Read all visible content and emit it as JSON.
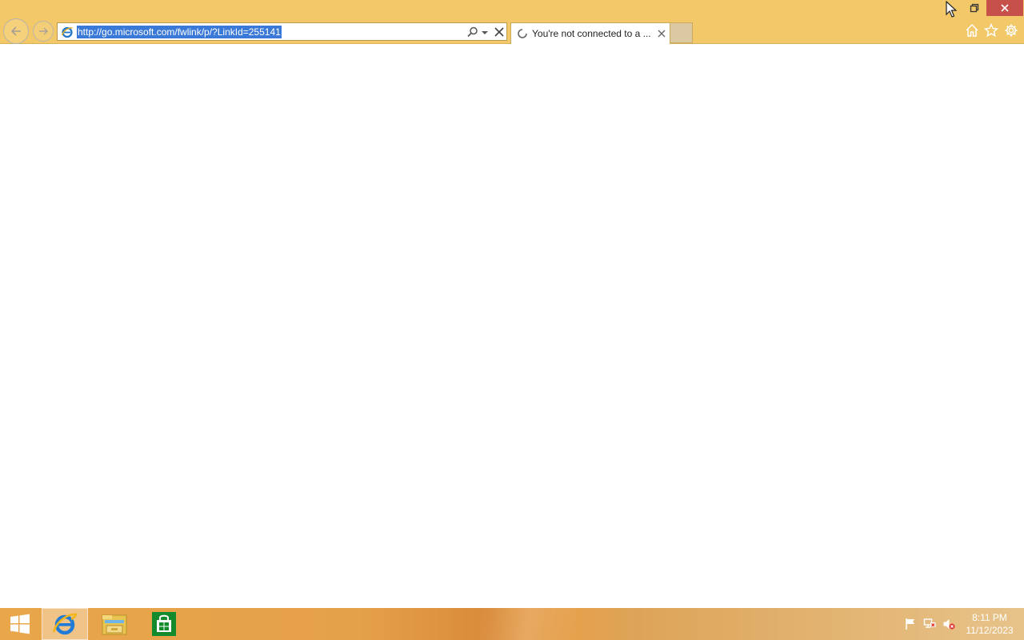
{
  "browser": {
    "address_bar": {
      "url": "http://go.microsoft.com/fwlink/p/?LinkId=255141"
    },
    "tabs": [
      {
        "title": "You're not connected to a ...",
        "state": "loading"
      }
    ],
    "icons": {
      "back": "back-arrow-icon",
      "forward": "forward-arrow-icon",
      "favicon": "ie-favicon-icon",
      "search": "search-icon",
      "dropdown": "chevron-down-icon",
      "stop": "close-icon",
      "home": "home-icon",
      "favorites": "star-icon",
      "tools": "gear-icon",
      "restore": "restore-window-icon",
      "close_window": "close-icon"
    },
    "colors": {
      "chrome": "#f2c868",
      "url_selection": "#3a79d8",
      "close_button": "#c7504a"
    }
  },
  "taskbar": {
    "pinned": [
      {
        "name": "Start",
        "icon": "windows-logo-icon"
      },
      {
        "name": "Internet Explorer",
        "icon": "ie-icon",
        "active": true
      },
      {
        "name": "File Explorer",
        "icon": "folder-icon"
      },
      {
        "name": "Store",
        "icon": "store-icon"
      }
    ],
    "tray_icons": [
      "flag-icon",
      "network-icon",
      "speaker-muted-icon"
    ],
    "clock": {
      "time": "8:11 PM",
      "date": "11/12/2023"
    }
  }
}
